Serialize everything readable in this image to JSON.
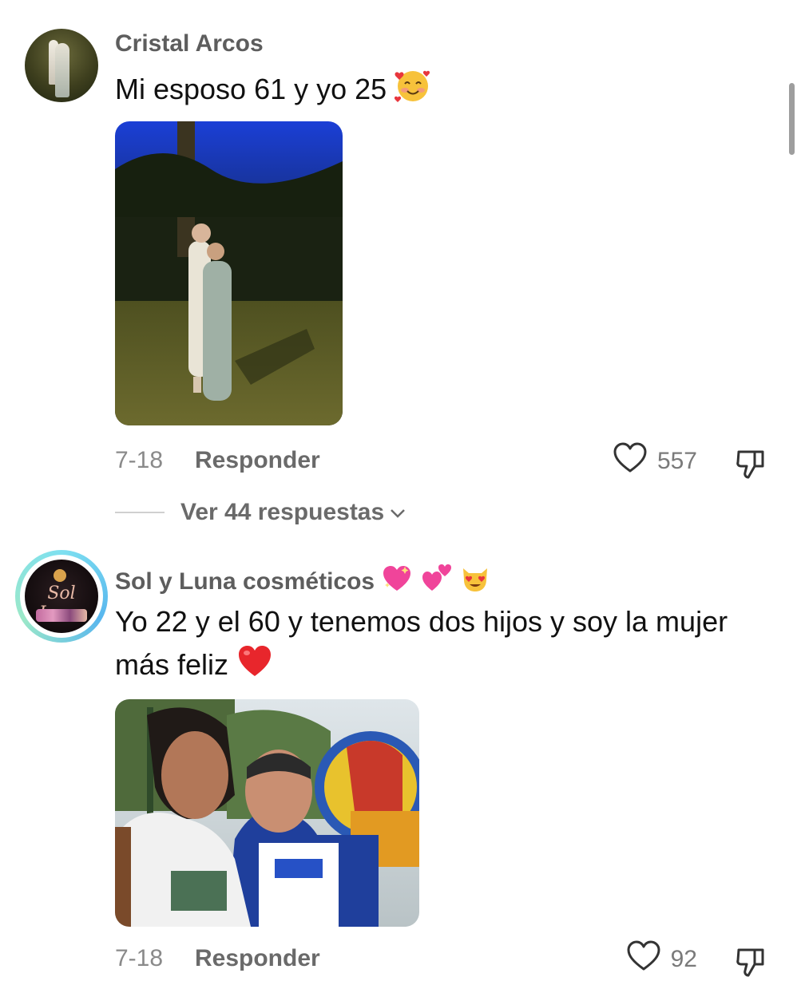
{
  "comments": [
    {
      "username": "Cristal Arcos",
      "text": "Mi esposo 61 y yo 25",
      "text_emoji": "smiling-face-with-hearts",
      "date": "7-18",
      "reply_label": "Responder",
      "likes": "557",
      "view_replies": "Ver 44 respuestas"
    },
    {
      "username": "Sol y Luna cosméticos",
      "username_emojis": [
        "sparkling-heart",
        "two-hearts",
        "heart-eyes-cat"
      ],
      "text": "Yo 22 y el 60 y tenemos dos hijos y soy la mujer más feliz",
      "text_emoji": "red-heart",
      "avatar_logo_text": "Sol Luna",
      "date": "7-18",
      "reply_label": "Responder",
      "likes": "92"
    }
  ],
  "colors": {
    "username": "#5d5d5d",
    "meta": "#8a8a8a",
    "story_ring": "#58b6ee"
  }
}
